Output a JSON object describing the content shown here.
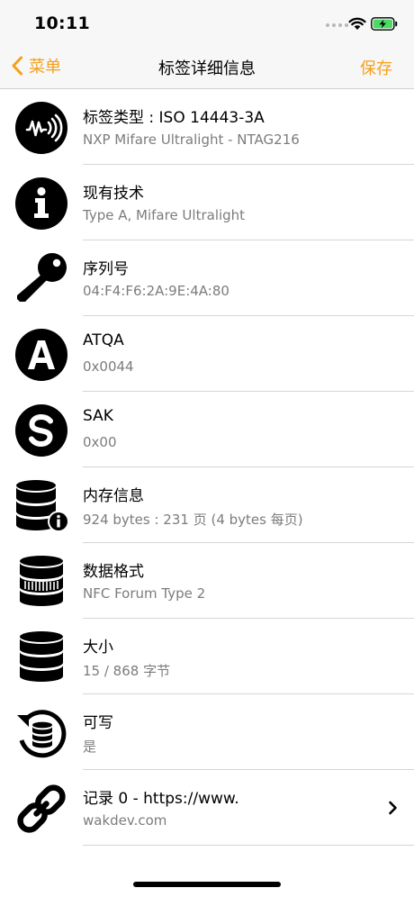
{
  "status_bar": {
    "time": "10:11"
  },
  "nav": {
    "back_label": "菜单",
    "title": "标签详细信息",
    "save_label": "保存"
  },
  "colors": {
    "accent": "#f5a01a",
    "icon_fill": "#000000",
    "battery_green": "#4cd964"
  },
  "rows": [
    {
      "icon": "nfc-waves-icon",
      "title": "标签类型 : ISO 14443-3A",
      "subtitle": "NXP Mifare Ultralight - NTAG216"
    },
    {
      "icon": "info-icon",
      "title": "现有技术",
      "subtitle": "Type A, Mifare Ultralight"
    },
    {
      "icon": "key-icon",
      "title": "序列号",
      "subtitle": "04:F4:F6:2A:9E:4A:80"
    },
    {
      "icon": "letter-a-icon",
      "title": "ATQA",
      "subtitle": "0x0044"
    },
    {
      "icon": "letter-s-icon",
      "title": "SAK",
      "subtitle": "0x00"
    },
    {
      "icon": "database-info-icon",
      "title": "内存信息",
      "subtitle": "924 bytes : 231 页 (4 bytes 每页)"
    },
    {
      "icon": "database-format-icon",
      "title": "数据格式",
      "subtitle": "NFC Forum Type 2"
    },
    {
      "icon": "database-icon",
      "title": "大小",
      "subtitle": "15 / 868 字节"
    },
    {
      "icon": "database-rewrite-icon",
      "title": "可写",
      "subtitle": "是"
    },
    {
      "icon": "link-icon",
      "title": "记录 0 - https://www.",
      "subtitle": "wakdev.com"
    }
  ]
}
